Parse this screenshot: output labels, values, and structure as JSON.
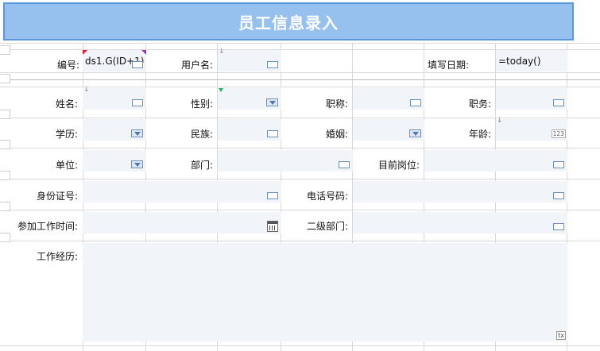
{
  "title": "员工信息录入",
  "header_row": {
    "id_label": "编号:",
    "id_value": "ds1.G(ID+1)",
    "username_label": "用户名:",
    "date_label": "填写日期:",
    "date_value": "=today()"
  },
  "fields": {
    "name": "姓名:",
    "gender": "性别:",
    "title": "职称:",
    "position": "职务:",
    "education": "学历:",
    "ethnicity": "民族:",
    "marital": "婚姻:",
    "age": "年龄:",
    "unit": "单位:",
    "department": "部门:",
    "current_post": "目前岗位:",
    "id_card": "身份证号:",
    "phone": "电话号码:",
    "start_work": "参加工作时间:",
    "sub_department": "二级部门:",
    "work_history": "工作经历:"
  },
  "widgets": {
    "number_badge": "123",
    "textarea_badge": "tx"
  },
  "colors": {
    "title_bg": "#96c1ef",
    "title_border": "#5a97dd",
    "field_bg": "#f1f4f8"
  },
  "icons": [
    "dropdown-arrow-icon",
    "calendar-icon",
    "textbox-icon"
  ]
}
